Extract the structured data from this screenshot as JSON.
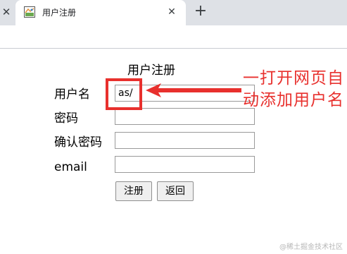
{
  "browser": {
    "prev_tab_close": "✕",
    "tab_title": "用户注册",
    "tab_close": "✕",
    "new_tab": "+"
  },
  "form": {
    "title": "用户注册",
    "username_label": "用户名",
    "username_value": "as/",
    "password_label": "密码",
    "password_value": "",
    "confirm_label": "确认密码",
    "confirm_value": "",
    "email_label": "email",
    "email_value": "",
    "register_button": "注册",
    "back_button": "返回"
  },
  "annotation": {
    "text": "一打开网页自动添加用户名",
    "color": "#e8302d"
  },
  "watermark": "@稀土掘金技术社区"
}
